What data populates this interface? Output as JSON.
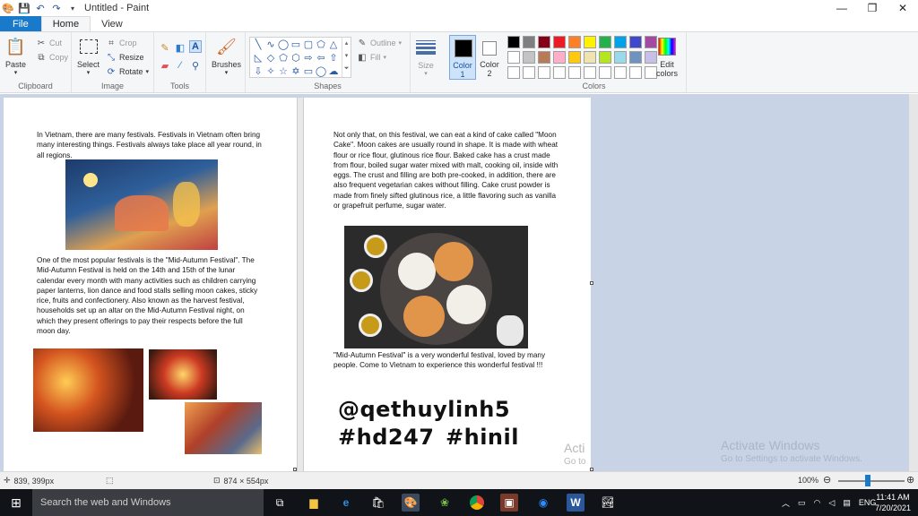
{
  "titlebar": {
    "title": "Untitled - Paint",
    "minimize": "—",
    "maximize": "❐",
    "close": "✕"
  },
  "tabs": {
    "file": "File",
    "home": "Home",
    "view": "View"
  },
  "ribbon": {
    "clipboard": {
      "label": "Clipboard",
      "paste": "Paste",
      "cut": "Cut",
      "copy": "Copy"
    },
    "image": {
      "label": "Image",
      "select": "Select",
      "crop": "Crop",
      "resize": "Resize",
      "rotate": "Rotate"
    },
    "tools": {
      "label": "Tools"
    },
    "brushes": {
      "label": "Brushes"
    },
    "shapes": {
      "label": "Shapes",
      "outline": "Outline",
      "fill": "Fill"
    },
    "size": {
      "label": "Size"
    },
    "color1": {
      "label": "Color",
      "num": "1"
    },
    "color2": {
      "label": "Color",
      "num": "2"
    },
    "colors": {
      "label": "Colors",
      "edit": "Edit",
      "edit2": "colors"
    }
  },
  "palette": {
    "row1": [
      "#000000",
      "#7f7f7f",
      "#880015",
      "#ed1c24",
      "#ff7f27",
      "#fff200",
      "#22b14c",
      "#00a2e8",
      "#3f48cc",
      "#a349a4"
    ],
    "row2": [
      "#ffffff",
      "#c3c3c3",
      "#b97a57",
      "#ffaec9",
      "#ffc90e",
      "#efe4b0",
      "#b5e61d",
      "#99d9ea",
      "#7092be",
      "#c8bfe7"
    ],
    "row3": [
      "#ffffff",
      "#ffffff",
      "#ffffff",
      "#ffffff",
      "#ffffff",
      "#ffffff",
      "#ffffff",
      "#ffffff",
      "#ffffff",
      "#ffffff"
    ]
  },
  "document": {
    "p1": "In Vietnam, there are many festivals. Festivals in Vietnam often bring many interesting things. Festivals always take place all year round, in all regions.",
    "p2": "One of the most popular festivals is the \"Mid-Autumn Festival\". The Mid-Autumn Festival is held on the 14th and 15th of the lunar calendar every month with many activities such as children carrying paper lanterns, lion dance and food stalls selling moon cakes, sticky rice, fruits and confectionery. Also known as the harvest festival, households set up an altar on the Mid-Autumn Festival night, on which they present offerings to pay their respects before the full moon day.",
    "p3": "Not only that, on this festival, we can eat a kind of cake called \"Moon Cake\". Moon cakes are usually round in shape. It is made with wheat flour or rice flour, glutinous rice flour. Baked cake has a crust made from flour, boiled sugar water mixed with malt, cooking oil, inside with eggs. The crust and filling are both pre-cooked, in addition, there are also frequent vegetarian cakes without filling. Cake crust powder is made from finely sifted glutinous rice, a little flavoring such as vanilla or grapefruit perfume, sugar water.",
    "p4": "\"Mid-Autumn Festival\" is a very wonderful festival, loved by many people. Come to Vietnam to experience this wonderful festival !!!",
    "tag1": "@qethuylinh5",
    "tag2": "#hd247",
    "tag3": "#hinil",
    "watermark1": "Acti",
    "watermark2": "Go to"
  },
  "activate": {
    "line1": "Activate Windows",
    "line2": "Go to Settings to activate Windows."
  },
  "statusbar": {
    "cursor": "839, 399px",
    "canvas_size": "874 × 554px",
    "zoom": "100%",
    "zoom_level": 0.4
  },
  "taskbar": {
    "search": "Search the web and Windows",
    "lang": "ENG",
    "time": "11:41 AM",
    "date": "7/20/2021"
  }
}
